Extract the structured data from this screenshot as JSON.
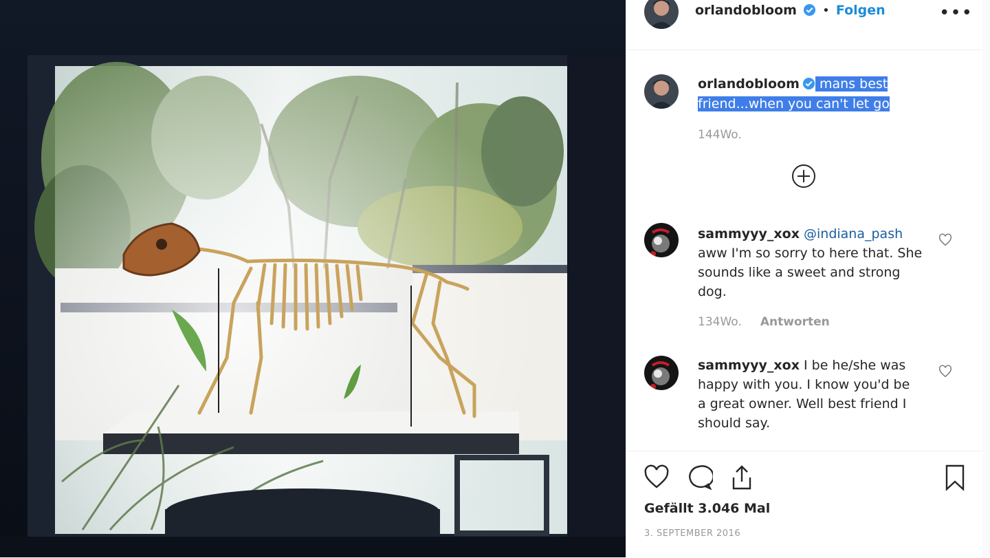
{
  "post": {
    "username": "orlandobloom",
    "follow_label": "Folgen",
    "more_label": "•••",
    "caption_user": "orlandobloom",
    "caption_line1": "mans best",
    "caption_line2": "friend...when you can't let go",
    "caption_time": "144Wo.",
    "likes": "Gefällt 3.046 Mal",
    "date": "3. SEPTEMBER 2016"
  },
  "comments": [
    {
      "user": "sammyyy_xox",
      "mention": "@indiana_pash",
      "line1_rest": "",
      "lines": [
        "aww I'm so sorry to here that. She",
        "sounds like a sweet and strong",
        "dog."
      ],
      "time": "134Wo.",
      "reply_label": "Antworten"
    },
    {
      "user": "sammyyy_xox",
      "line1_rest": "I be he/she was",
      "lines": [
        "happy with you. I know you'd be",
        "a great owner. Well best friend I",
        "should say."
      ]
    }
  ],
  "icons": [
    "verified-badge-icon",
    "plus-circle-icon",
    "heart-icon",
    "comment-icon",
    "share-icon",
    "bookmark-icon"
  ],
  "colors": {
    "link": "#1a8cd8",
    "selection": "#3f7ee8",
    "muted": "#999999"
  }
}
